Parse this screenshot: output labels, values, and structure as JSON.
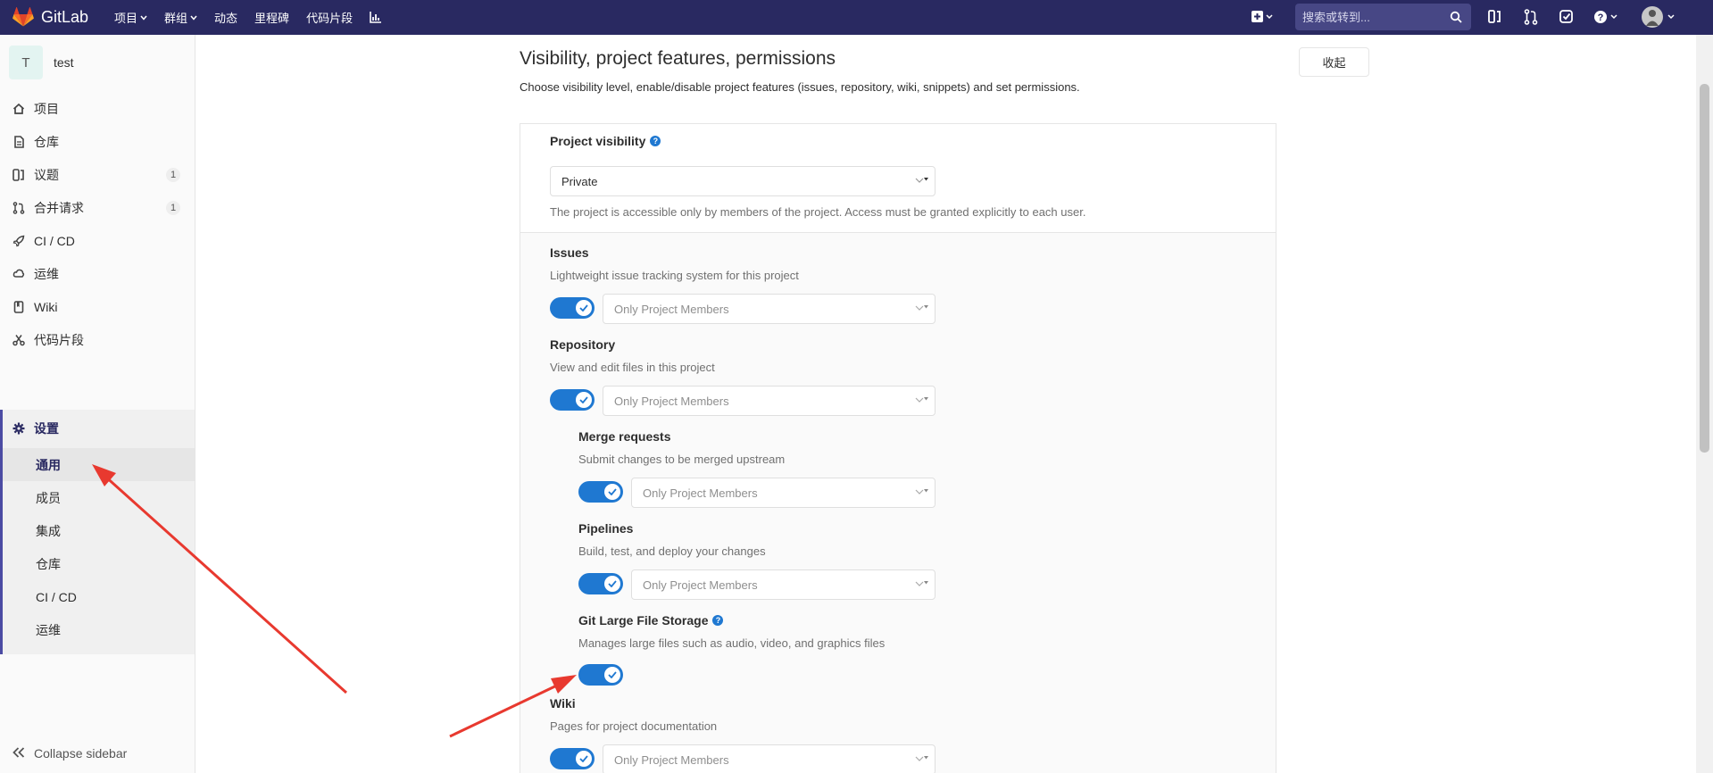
{
  "navbar": {
    "brand": "GitLab",
    "items": [
      {
        "label": "项目",
        "dropdown": true
      },
      {
        "label": "群组",
        "dropdown": true
      },
      {
        "label": "动态",
        "dropdown": false
      },
      {
        "label": "里程碑",
        "dropdown": false
      },
      {
        "label": "代码片段",
        "dropdown": false
      }
    ],
    "search_placeholder": "搜索或转到...",
    "icons": [
      "plus-icon",
      "search-icon",
      "issues-icon",
      "merge-request-icon",
      "todo-icon",
      "help-icon",
      "avatar"
    ],
    "color": "#292961"
  },
  "sidebar": {
    "project_avatar_letter": "T",
    "project_name": "test",
    "items": [
      {
        "label": "项目",
        "icon": "home-icon"
      },
      {
        "label": "仓库",
        "icon": "doc-icon"
      },
      {
        "label": "议题",
        "icon": "issues-icon",
        "badge": "1"
      },
      {
        "label": "合并请求",
        "icon": "merge-request-icon",
        "badge": "1"
      },
      {
        "label": "CI / CD",
        "icon": "rocket-icon"
      },
      {
        "label": "运维",
        "icon": "cloud-icon"
      },
      {
        "label": "Wiki",
        "icon": "book-icon"
      },
      {
        "label": "代码片段",
        "icon": "scissors-icon"
      }
    ],
    "settings_label": "设置",
    "settings_sub": [
      "通用",
      "成员",
      "集成",
      "仓库",
      "CI / CD",
      "运维"
    ],
    "current_sub": "通用",
    "collapse_label": "Collapse sidebar"
  },
  "section": {
    "title": "Visibility, project features, permissions",
    "description": "Choose visibility level, enable/disable project features (issues, repository, wiki, snippets) and set permissions.",
    "collapse_button": "收起"
  },
  "visibility": {
    "label": "Project visibility",
    "value": "Private",
    "hint": "The project is accessible only by members of the project. Access must be granted explicitly to each user."
  },
  "features": [
    {
      "name": "Issues",
      "description": "Lightweight issue tracking system for this project",
      "enabled": true,
      "access": "Only Project Members"
    },
    {
      "name": "Repository",
      "description": "View and edit files in this project",
      "enabled": true,
      "access": "Only Project Members"
    },
    {
      "name": "Merge requests",
      "description": "Submit changes to be merged upstream",
      "enabled": true,
      "access": "Only Project Members"
    },
    {
      "name": "Pipelines",
      "description": "Build, test, and deploy your changes",
      "enabled": true,
      "access": "Only Project Members"
    },
    {
      "name": "Git Large File Storage",
      "description": "Manages large files such as audio, video, and graphics files",
      "enabled": true
    },
    {
      "name": "Wiki",
      "description": "Pages for project documentation",
      "enabled": true,
      "access": "Only Project Members"
    }
  ],
  "colors": {
    "toggle": "#1f78d1",
    "annotation_arrow": "#e8392f"
  }
}
